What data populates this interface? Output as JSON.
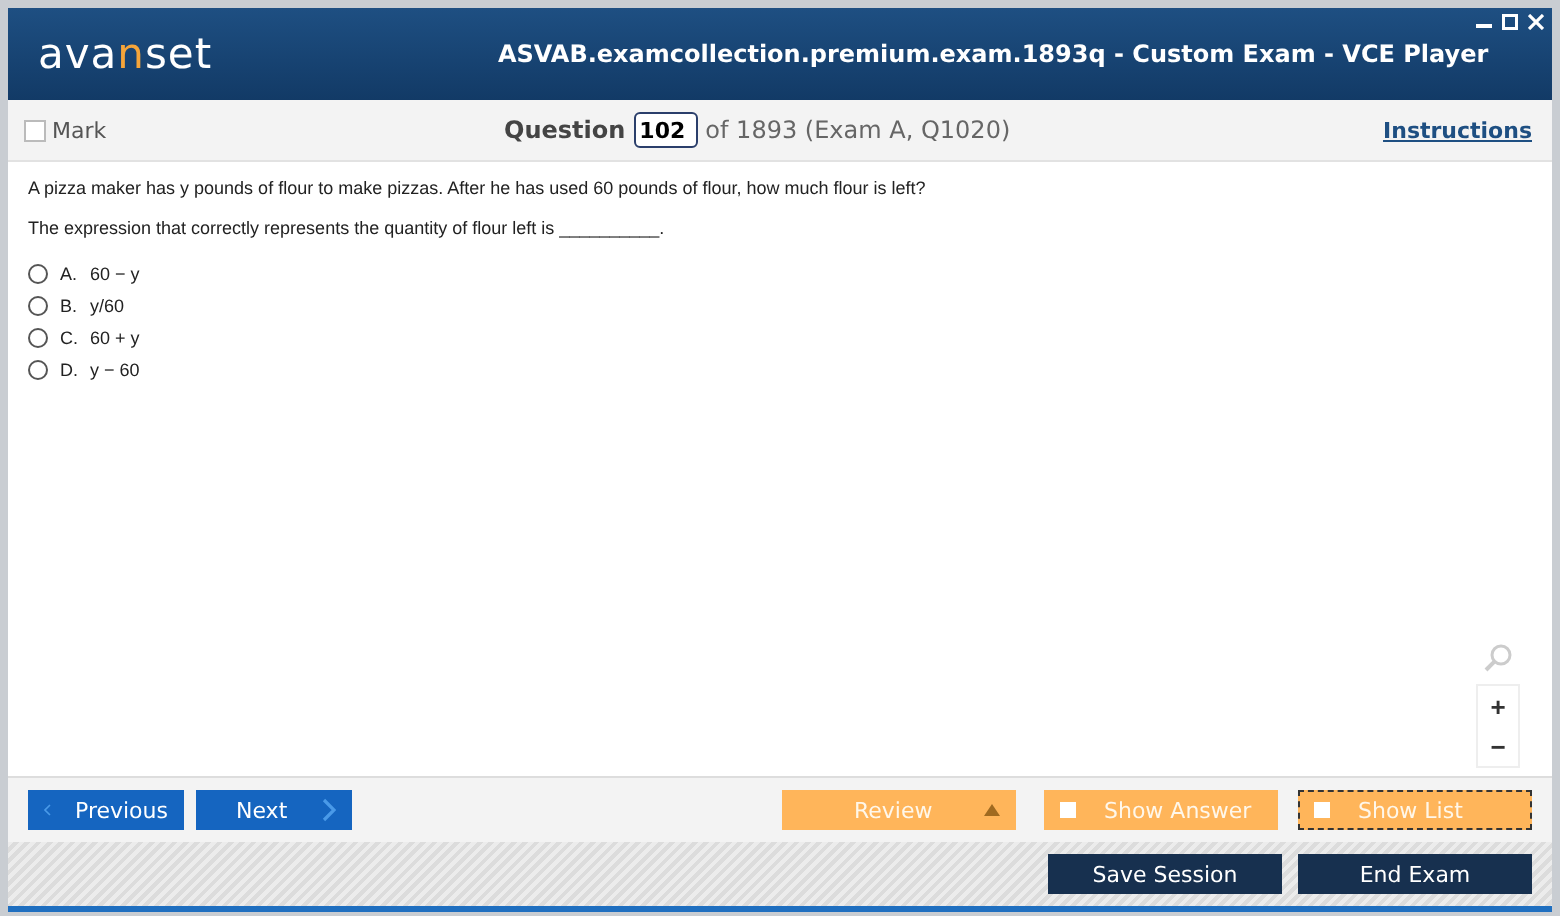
{
  "window": {
    "title": "ASVAB.examcollection.premium.exam.1893q - Custom Exam - VCE Player"
  },
  "logo": [
    {
      "text": "ava",
      "accent": false
    },
    {
      "text": "n",
      "accent": true
    },
    {
      "text": "set",
      "accent": false
    }
  ],
  "toolbar": {
    "mark": {
      "label": "Mark",
      "checked": false
    },
    "question_label": "Question",
    "question_value": "102",
    "question_of": "of 1893 (Exam A, Q1020)",
    "instructions": "Instructions"
  },
  "question": {
    "text": "A pizza maker has y pounds of flour to make pizzas. After he has used 60 pounds of flour, how much flour is left?",
    "prompt": "The expression that correctly represents the quantity of flour left is __________.",
    "options": [
      {
        "letter": "A.",
        "text": "60 − y",
        "selected": false
      },
      {
        "letter": "B.",
        "text": "y/60",
        "selected": false
      },
      {
        "letter": "C.",
        "text": "60 + y",
        "selected": false
      },
      {
        "letter": "D.",
        "text": "y − 60",
        "selected": false
      }
    ]
  },
  "zoom": {
    "in": "+",
    "out": "−"
  },
  "nav": {
    "previous": "Previous",
    "next": "Next",
    "review": "Review",
    "show_answer": {
      "label": "Show Answer",
      "checked": false
    },
    "show_list": {
      "label": "Show List",
      "checked": false
    }
  },
  "footer": {
    "save": "Save Session",
    "end": "End Exam"
  }
}
